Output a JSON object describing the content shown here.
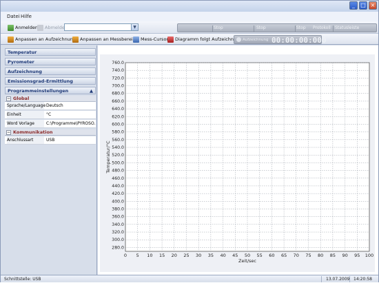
{
  "menu": {
    "file": "Datei",
    "help": "Hilfe"
  },
  "toolbar1": {
    "login": "Anmelden",
    "logout": "Abmelden",
    "combo_value": "",
    "right_items": [
      "Stop",
      "Stop",
      "Stop",
      "Protokoll",
      "Statusleiste",
      "Einstellung"
    ]
  },
  "toolbar2": {
    "fit_recording": "Anpassen an Aufzeichnung",
    "fit_range": "Anpassen an Messbereich",
    "cursor": "Mess-Cursor",
    "follow": "Diagramm folgt Aufzeichnung",
    "rec_label": "Aufzeichnung",
    "rec_time": "00:00:00:000"
  },
  "sidebar": {
    "sections": [
      "Temperatur",
      "Pyrometer",
      "Aufzeichnung",
      "Emissionsgrad-Ermittlung",
      "Programmeinstellungen"
    ],
    "group_global": "Global",
    "props": [
      {
        "key": "Sprache/Language",
        "value": "Deutsch"
      },
      {
        "key": "Einheit",
        "value": "°C"
      },
      {
        "key": "Word Vorlage",
        "value": "C:\\Programme\\PYROSO..."
      }
    ],
    "group_comm": "Kommunikation",
    "comm_props": [
      {
        "key": "Anschlussart",
        "value": "USB"
      }
    ]
  },
  "chart_data": {
    "type": "line",
    "xlabel": "Zeit/sec",
    "ylabel": "Temperatur/°C",
    "xlim": [
      0,
      100
    ],
    "ylim": [
      270,
      760
    ],
    "x_ticks": [
      "0",
      "5",
      "10",
      "15",
      "20",
      "25",
      "30",
      "35",
      "40",
      "45",
      "50",
      "55",
      "60",
      "65",
      "70",
      "75",
      "80",
      "85",
      "90",
      "95",
      "100"
    ],
    "y_ticks": [
      "280.0",
      "300.0",
      "320.0",
      "340.0",
      "360.0",
      "380.0",
      "400.0",
      "420.0",
      "440.0",
      "460.0",
      "480.0",
      "500.0",
      "520.0",
      "540.0",
      "560.0",
      "580.0",
      "600.0",
      "620.0",
      "640.0",
      "660.0",
      "680.0",
      "700.0",
      "720.0",
      "740.0",
      "760.0"
    ],
    "grid": true,
    "series": []
  },
  "status": {
    "interface": "Schnittstelle: USB",
    "date": "13.07.2009",
    "time": "14:20:58"
  }
}
